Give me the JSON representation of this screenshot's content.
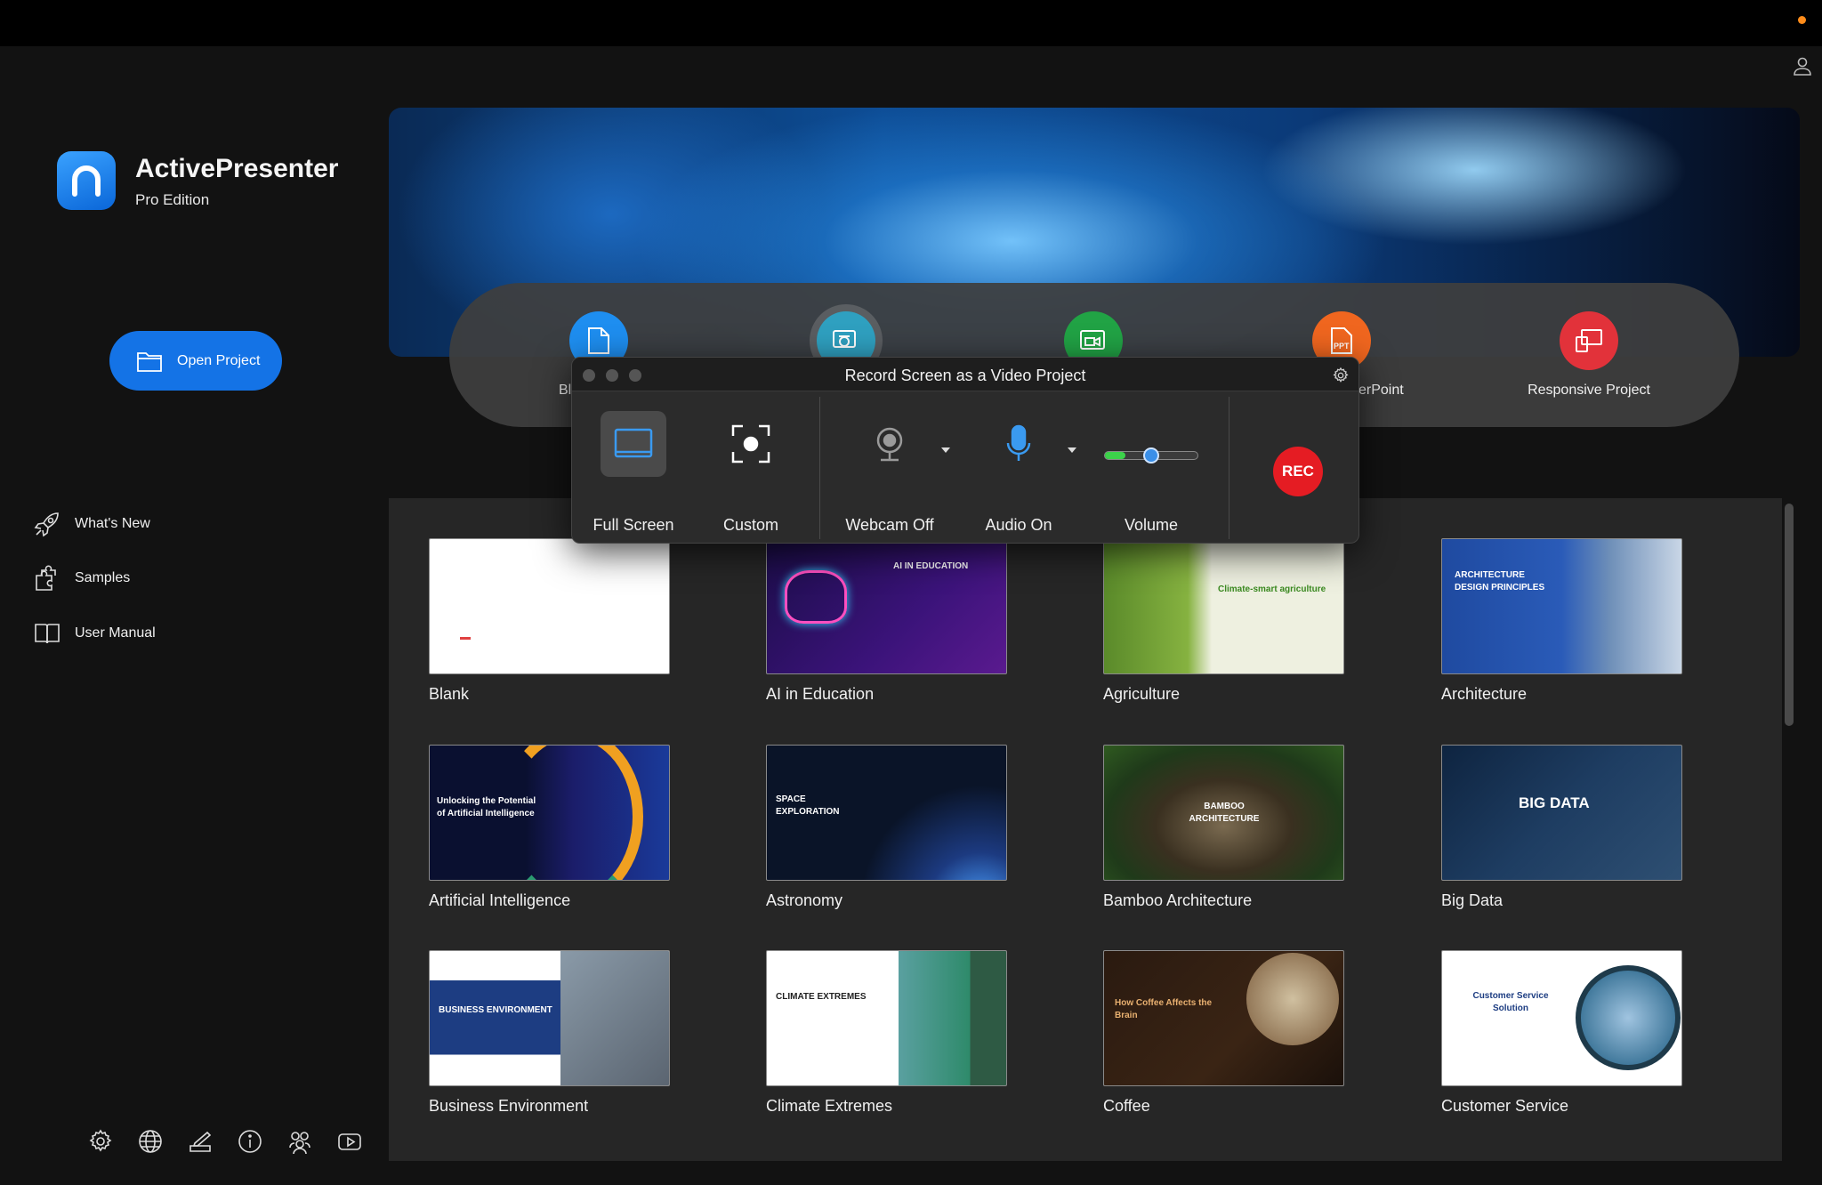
{
  "app": {
    "name": "ActivePresenter",
    "edition": "Pro Edition"
  },
  "sidebar": {
    "open_project": "Open Project",
    "items": [
      {
        "label": "What's New",
        "icon": "rocket-icon"
      },
      {
        "label": "Samples",
        "icon": "puzzle-icon"
      },
      {
        "label": "User Manual",
        "icon": "book-icon"
      }
    ],
    "bottom_icons": [
      "gear-icon",
      "globe-icon",
      "pen-icon",
      "info-icon",
      "community-icon",
      "youtube-icon"
    ]
  },
  "actions": {
    "blank_partial": "Bl",
    "powerpoint_partial": "erPoint",
    "responsive": "Responsive Project"
  },
  "dialog": {
    "title": "Record Screen as a Video Project",
    "full_screen": "Full Screen",
    "custom": "Custom",
    "webcam": "Webcam Off",
    "audio": "Audio On",
    "volume": "Volume",
    "volume_level": 0.5,
    "rec": "REC"
  },
  "templates": [
    {
      "name": "Blank"
    },
    {
      "name": "AI in Education",
      "thumb_text": "AI IN EDUCATION"
    },
    {
      "name": "Agriculture",
      "thumb_text": "Climate-smart agriculture"
    },
    {
      "name": "Architecture",
      "thumb_text": "ARCHITECTURE DESIGN PRINCIPLES"
    },
    {
      "name": "Artificial Intelligence",
      "thumb_text": "Unlocking the Potential of Artificial Intelligence"
    },
    {
      "name": "Astronomy",
      "thumb_text": "SPACE EXPLORATION"
    },
    {
      "name": "Bamboo Architecture",
      "thumb_text": "BAMBOO ARCHITECTURE"
    },
    {
      "name": "Big Data",
      "thumb_text": "BIG DATA"
    },
    {
      "name": "Business Environment",
      "thumb_text": "BUSINESS ENVIRONMENT"
    },
    {
      "name": "Climate Extremes",
      "thumb_text": "CLIMATE EXTREMES"
    },
    {
      "name": "Coffee",
      "thumb_text": "How Coffee Affects the Brain"
    },
    {
      "name": "Customer Service",
      "thumb_text": "Customer Service Solution"
    }
  ],
  "colors": {
    "accent": "#1473e6",
    "rec": "#e51c23",
    "status": "#ff8c1a"
  }
}
